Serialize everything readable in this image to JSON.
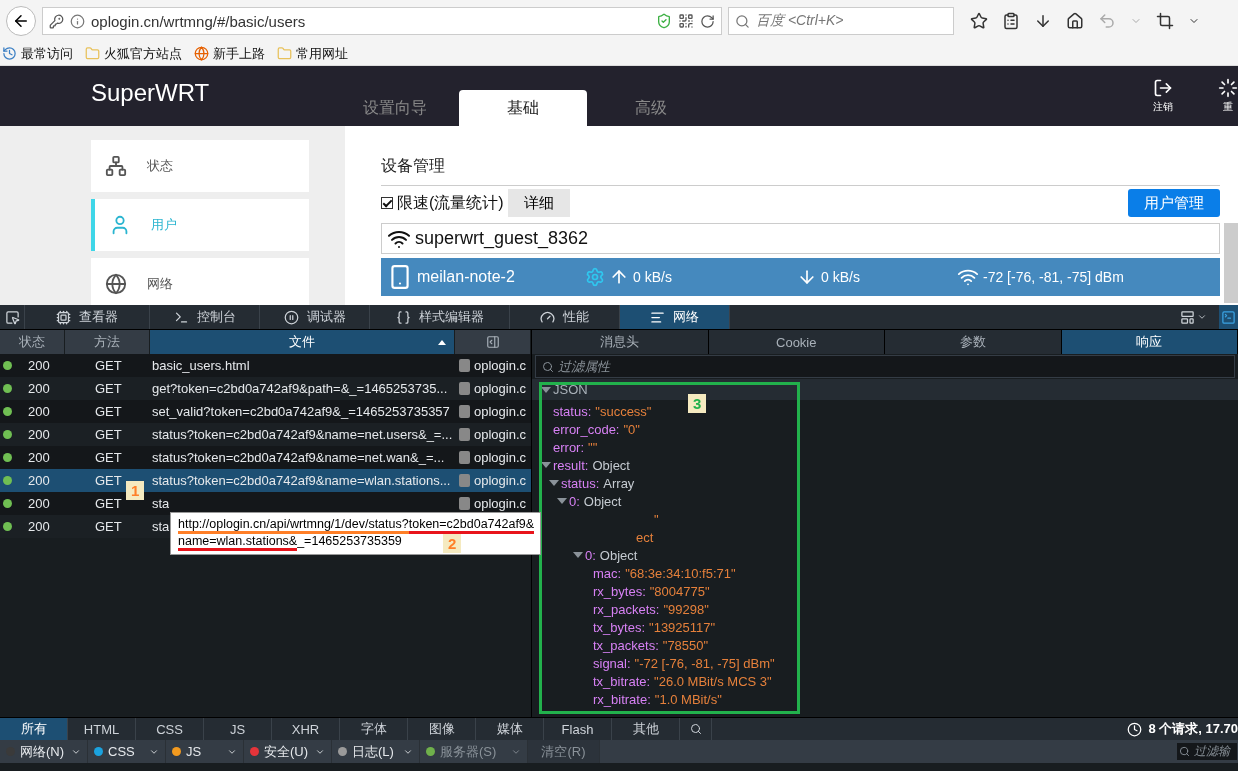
{
  "browser": {
    "url": "oplogin.cn/wrtmng/#/basic/users",
    "search_placeholder": "百度 <Ctrl+K>",
    "bookmarks": [
      {
        "label": "最常访问",
        "kind": "recent"
      },
      {
        "label": "火狐官方站点",
        "kind": "folder"
      },
      {
        "label": "新手上路",
        "kind": "firefox"
      },
      {
        "label": "常用网址",
        "kind": "folder"
      }
    ]
  },
  "app": {
    "logo": "SuperWRT",
    "tabs": [
      {
        "label": "设置向导",
        "selected": false
      },
      {
        "label": "基础",
        "selected": true
      },
      {
        "label": "高级",
        "selected": false
      }
    ],
    "actions": [
      {
        "label": "注销"
      },
      {
        "label": "重"
      }
    ],
    "sidebar": [
      {
        "label": "状态",
        "selected": false
      },
      {
        "label": "用户",
        "selected": true
      },
      {
        "label": "网络",
        "selected": false
      }
    ],
    "section_title": "设备管理",
    "speed_limit": {
      "label": "限速(流量统计)",
      "checked": true
    },
    "detail_button": "详细",
    "manage_button": "用户管理",
    "network": {
      "ssid": "superwrt_guest_8362"
    },
    "devices": [
      {
        "name": "meilan-note-2",
        "selected": true,
        "up": "0 kB/s",
        "down": "0 kB/s",
        "signal": "-72 [-76, -81, -75] dBm"
      }
    ]
  },
  "devtools": {
    "tools": [
      {
        "label": "查看器",
        "selected": false
      },
      {
        "label": "控制台",
        "selected": false
      },
      {
        "label": "调试器",
        "selected": false
      },
      {
        "label": "样式编辑器",
        "selected": false
      },
      {
        "label": "性能",
        "selected": false
      },
      {
        "label": "网络",
        "selected": true
      }
    ],
    "columns": [
      {
        "label": "状态",
        "selected": false
      },
      {
        "label": "方法",
        "selected": false
      },
      {
        "label": "文件",
        "selected": true
      }
    ],
    "requests": [
      {
        "status": "200",
        "method": "GET",
        "file": "basic_users.html",
        "domain": "oplogin.c",
        "selected": false
      },
      {
        "status": "200",
        "method": "GET",
        "file": "get?token=c2bd0a742af9&path=&_=1465253735...",
        "domain": "oplogin.c",
        "selected": false
      },
      {
        "status": "200",
        "method": "GET",
        "file": "set_valid?token=c2bd0a742af9&_=1465253735357",
        "domain": "oplogin.c",
        "selected": false
      },
      {
        "status": "200",
        "method": "GET",
        "file": "status?token=c2bd0a742af9&name=net.users&_=...",
        "domain": "oplogin.c",
        "selected": false
      },
      {
        "status": "200",
        "method": "GET",
        "file": "status?token=c2bd0a742af9&name=net.wan&_=...",
        "domain": "oplogin.c",
        "selected": false
      },
      {
        "status": "200",
        "method": "GET",
        "file": "status?token=c2bd0a742af9&name=wlan.stations...",
        "domain": "oplogin.c",
        "selected": true
      },
      {
        "status": "200",
        "method": "GET",
        "file": "sta",
        "domain": "oplogin.c",
        "selected": false
      },
      {
        "status": "200",
        "method": "GET",
        "file": "sta",
        "selected": false
      }
    ],
    "panel_tabs": [
      {
        "label": "消息头",
        "selected": false
      },
      {
        "label": "Cookie",
        "selected": false
      },
      {
        "label": "参数",
        "selected": false
      },
      {
        "label": "响应",
        "selected": true
      }
    ],
    "filter_placeholder": "过滤属性",
    "json": {
      "label": "JSON",
      "expanded": true,
      "children": [
        {
          "key": "status:",
          "value": "\"success\"",
          "kind": "string"
        },
        {
          "key": "error_code:",
          "value": "\"0\"",
          "kind": "string"
        },
        {
          "key": "error:",
          "value": "\"\"",
          "kind": "string"
        },
        {
          "key": "result:",
          "value": "Object",
          "kind": "object",
          "expanded": true,
          "children": [
            {
              "key": "status:",
              "value": "Array",
              "kind": "object",
              "expanded": true,
              "children": [
                {
                  "key": "0:",
                  "value": "Object",
                  "kind": "object",
                  "expanded": true,
                  "children": [
                    {
                      "value": "\"",
                      "kind": "partial"
                    },
                    {
                      "value": "ect",
                      "kind": "partial",
                      "children": [
                        {
                          "key": "0:",
                          "value": "Object",
                          "kind": "object",
                          "expanded": true,
                          "children": [
                            {
                              "key": "mac:",
                              "value": "\"68:3e:34:10:f5:71\"",
                              "kind": "string"
                            },
                            {
                              "key": "rx_bytes:",
                              "value": "\"8004775\"",
                              "kind": "string"
                            },
                            {
                              "key": "rx_packets:",
                              "value": "\"99298\"",
                              "kind": "string"
                            },
                            {
                              "key": "tx_bytes:",
                              "value": "\"13925117\"",
                              "kind": "string"
                            },
                            {
                              "key": "tx_packets:",
                              "value": "\"78550\"",
                              "kind": "string"
                            },
                            {
                              "key": "signal:",
                              "value": "\"-72 [-76, -81, -75] dBm\"",
                              "kind": "string"
                            },
                            {
                              "key": "tx_bitrate:",
                              "value": "\"26.0 MBit/s MCS 3\"",
                              "kind": "string"
                            },
                            {
                              "key": "rx_bitrate:",
                              "value": "\"1.0 MBit/s\"",
                              "kind": "string"
                            }
                          ]
                        }
                      ]
                    }
                  ]
                }
              ]
            }
          ]
        }
      ]
    },
    "type_filters": [
      {
        "label": "所有",
        "selected": true
      },
      {
        "label": "HTML",
        "selected": false
      },
      {
        "label": "CSS",
        "selected": false
      },
      {
        "label": "JS",
        "selected": false
      },
      {
        "label": "XHR",
        "selected": false
      },
      {
        "label": "字体",
        "selected": false
      },
      {
        "label": "图像",
        "selected": false
      },
      {
        "label": "媒体",
        "selected": false
      },
      {
        "label": "Flash",
        "selected": false
      },
      {
        "label": "其他",
        "selected": false
      }
    ],
    "summary": "8 个请求, 17.70",
    "log_filters": [
      {
        "label": "网络(N)",
        "color": "#3a3a3a",
        "disabled": false
      },
      {
        "label": "CSS",
        "color": "#1ba2de",
        "disabled": false
      },
      {
        "label": "JS",
        "color": "#f29a1f",
        "disabled": false
      },
      {
        "label": "安全(U)",
        "color": "#e5343a",
        "disabled": false
      },
      {
        "label": "日志(L)",
        "color": "#9a9a9a",
        "disabled": false
      },
      {
        "label": "服务器(S)",
        "color": "#6fb04b",
        "disabled": true
      }
    ],
    "clear_button": "清空(R)",
    "filter2_placeholder": "过滤输"
  },
  "annotations": {
    "tooltip": [
      [
        {
          "text": "http://oplogin.cn/api/wrtmng/1/dev/status?",
          "color": "#ff7f27"
        },
        {
          "text": "token=c2bd0a742af9&",
          "color": "#e8141b"
        }
      ],
      [
        {
          "text": "name=wlan.stations&",
          "color": "#e8141b"
        },
        {
          "text": "_=1465253735359"
        }
      ]
    ],
    "badges": [
      {
        "label": "1",
        "color": "#ff7f27"
      },
      {
        "label": "2",
        "color": "#ff7f27"
      },
      {
        "label": "3",
        "color": "#22b14c"
      }
    ]
  }
}
